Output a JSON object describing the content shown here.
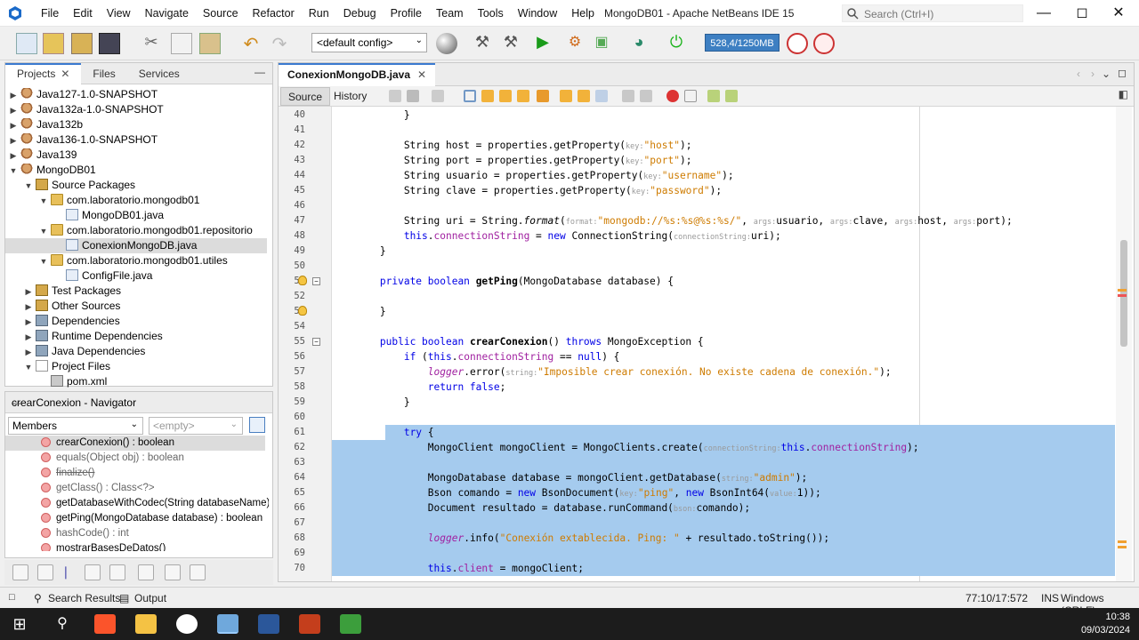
{
  "window": {
    "title": "MongoDB01 - Apache NetBeans IDE 15",
    "search_placeholder": "Search (Ctrl+I)",
    "menus": [
      "File",
      "Edit",
      "View",
      "Navigate",
      "Source",
      "Refactor",
      "Run",
      "Debug",
      "Profile",
      "Team",
      "Tools",
      "Window",
      "Help"
    ]
  },
  "toolbar": {
    "config": "<default config>",
    "memory": "528,4/1250MB"
  },
  "projects": {
    "tabs": [
      "Projects",
      "Files",
      "Services"
    ],
    "tree": [
      {
        "label": "Java127-1.0-SNAPSHOT",
        "depth": 0,
        "arrow": "▶",
        "icon": "cup"
      },
      {
        "label": "Java132a-1.0-SNAPSHOT",
        "depth": 0,
        "arrow": "▶",
        "icon": "cup"
      },
      {
        "label": "Java132b",
        "depth": 0,
        "arrow": "▶",
        "icon": "cup"
      },
      {
        "label": "Java136-1.0-SNAPSHOT",
        "depth": 0,
        "arrow": "▶",
        "icon": "cup"
      },
      {
        "label": "Java139",
        "depth": 0,
        "arrow": "▶",
        "icon": "cup"
      },
      {
        "label": "MongoDB01",
        "depth": 0,
        "arrow": "▼",
        "icon": "cup"
      },
      {
        "label": "Source Packages",
        "depth": 1,
        "arrow": "▼",
        "icon": "srcpkg"
      },
      {
        "label": "com.laboratorio.mongodb01",
        "depth": 2,
        "arrow": "▼",
        "icon": "pkg"
      },
      {
        "label": "MongoDB01.java",
        "depth": 3,
        "arrow": "",
        "icon": "java"
      },
      {
        "label": "com.laboratorio.mongodb01.repositorio",
        "depth": 2,
        "arrow": "▼",
        "icon": "pkg"
      },
      {
        "label": "ConexionMongoDB.java",
        "depth": 3,
        "arrow": "",
        "icon": "java",
        "selected": true
      },
      {
        "label": "com.laboratorio.mongodb01.utiles",
        "depth": 2,
        "arrow": "▼",
        "icon": "pkg"
      },
      {
        "label": "ConfigFile.java",
        "depth": 3,
        "arrow": "",
        "icon": "java"
      },
      {
        "label": "Test Packages",
        "depth": 1,
        "arrow": "▶",
        "icon": "srcpkg"
      },
      {
        "label": "Other Sources",
        "depth": 1,
        "arrow": "▶",
        "icon": "srcpkg"
      },
      {
        "label": "Dependencies",
        "depth": 1,
        "arrow": "▶",
        "icon": "lib"
      },
      {
        "label": "Runtime Dependencies",
        "depth": 1,
        "arrow": "▶",
        "icon": "lib"
      },
      {
        "label": "Java Dependencies",
        "depth": 1,
        "arrow": "▶",
        "icon": "lib"
      },
      {
        "label": "Project Files",
        "depth": 1,
        "arrow": "▼",
        "icon": "file"
      },
      {
        "label": "pom.xml",
        "depth": 2,
        "arrow": "",
        "icon": "xml"
      }
    ]
  },
  "navigator": {
    "title": "crearConexion - Navigator",
    "filter": "Members",
    "empty": "<empty>",
    "members": [
      {
        "name": "crearConexion() : boolean",
        "selected": true
      },
      {
        "name": "equals(Object obj) : boolean",
        "gray": true
      },
      {
        "name": "finalize()",
        "gray": true,
        "strike": true
      },
      {
        "name": "getClass() : Class<?>",
        "gray": true
      },
      {
        "name": "getDatabaseWithCodec(String databaseName)"
      },
      {
        "name": "getPing(MongoDatabase database) : boolean"
      },
      {
        "name": "hashCode() : int",
        "gray": true
      },
      {
        "name": "mostrarBasesDeDatos()"
      }
    ]
  },
  "editor": {
    "tab": "ConexionMongoDB.java",
    "source": "Source",
    "history": "History",
    "lines": [
      {
        "n": "40",
        "html": "            }"
      },
      {
        "n": "41",
        "html": ""
      },
      {
        "n": "42",
        "html": "            String host = properties.getProperty(<span class='hint'>key:</span><span class='str'>\"host\"</span>);"
      },
      {
        "n": "43",
        "html": "            String port = properties.getProperty(<span class='hint'>key:</span><span class='str'>\"port\"</span>);"
      },
      {
        "n": "44",
        "html": "            String usuario = properties.getProperty(<span class='hint'>key:</span><span class='str'>\"username\"</span>);"
      },
      {
        "n": "45",
        "html": "            String clave = properties.getProperty(<span class='hint'>key:</span><span class='str'>\"password\"</span>);"
      },
      {
        "n": "46",
        "html": ""
      },
      {
        "n": "47",
        "html": "            String uri = String.<span class='it'>format</span>(<span class='hint'>format:</span><span class='str'>\"mongodb://%s:%s@%s:%s/\"</span>, <span class='hint'>args:</span>usuario, <span class='hint'>args:</span>clave, <span class='hint'>args:</span>host, <span class='hint'>args:</span>port);"
      },
      {
        "n": "48",
        "html": "            <span class='kw'>this</span>.<span class='pfld'>connectionString</span> = <span class='kw'>new</span> ConnectionString(<span class='hint'>connectionString:</span>uri);"
      },
      {
        "n": "49",
        "html": "        }"
      },
      {
        "n": "50",
        "html": ""
      },
      {
        "n": "51",
        "html": "        <span class='kw'>private boolean</span> <span class='fn'>getPing</span>(MongoDatabase database) {"
      },
      {
        "n": "52",
        "html": ""
      },
      {
        "n": "53",
        "html": "        }"
      },
      {
        "n": "54",
        "html": ""
      },
      {
        "n": "55",
        "html": "        <span class='kw'>public boolean</span> <span class='fn'>crearConexion</span>() <span class='kw'>throws</span> MongoException {"
      },
      {
        "n": "56",
        "html": "            <span class='kw'>if</span> (<span class='kw'>this</span>.<span class='pfld'>connectionString</span> == <span class='kw'>null</span>) {"
      },
      {
        "n": "57",
        "html": "                <span class='pfld it'>logger</span>.error(<span class='hint'>string:</span><span class='str'>\"Imposible crear conexión. No existe cadena de conexión.\"</span>);"
      },
      {
        "n": "58",
        "html": "                <span class='kw'>return false</span>;"
      },
      {
        "n": "59",
        "html": "            }"
      },
      {
        "n": "60",
        "html": ""
      },
      {
        "n": "61",
        "html": "            <span class='kw'>try</span> {",
        "sel": true
      },
      {
        "n": "62",
        "html": "                MongoClient mongoClient = MongoClients.create(<span class='hint'>connectionString:</span><span class='kw'>this</span>.<span class='pfld'>connectionString</span>);",
        "sel": true
      },
      {
        "n": "63",
        "html": "",
        "sel": true
      },
      {
        "n": "64",
        "html": "                MongoDatabase database = mongoClient.getDatabase(<span class='hint'>string:</span><span class='str'>\"admin\"</span>);",
        "sel": true
      },
      {
        "n": "65",
        "html": "                Bson comando = <span class='kw'>new</span> BsonDocument(<span class='hint'>key:</span><span class='str'>\"ping\"</span>, <span class='kw'>new</span> BsonInt64(<span class='hint'>value:</span>1));",
        "sel": true
      },
      {
        "n": "66",
        "html": "                Document resultado = database.runCommand(<span class='hint'>bson:</span>comando);",
        "sel": true
      },
      {
        "n": "67",
        "html": "",
        "sel": true
      },
      {
        "n": "68",
        "html": "                <span class='pfld it'>logger</span>.info(<span class='str'>\"Conexión extablecida. Ping: \"</span> + resultado.toString());",
        "sel": true
      },
      {
        "n": "69",
        "html": "",
        "sel": true
      },
      {
        "n": "70",
        "html": "                <span class='kw'>this</span>.<span class='pfld'>client</span> = mongoClient;",
        "sel": true
      }
    ]
  },
  "status": {
    "search_results": "Search Results",
    "output": "Output",
    "position": "77:10/17:572",
    "ins": "INS",
    "eol": "Windows (CRLF)"
  },
  "clock": {
    "time": "10:38",
    "date": "09/03/2024"
  },
  "colors": {
    "accent": "#3b7ad0",
    "selection": "#a5cbee",
    "keyword": "#0000e6",
    "string": "#ce7b00"
  }
}
